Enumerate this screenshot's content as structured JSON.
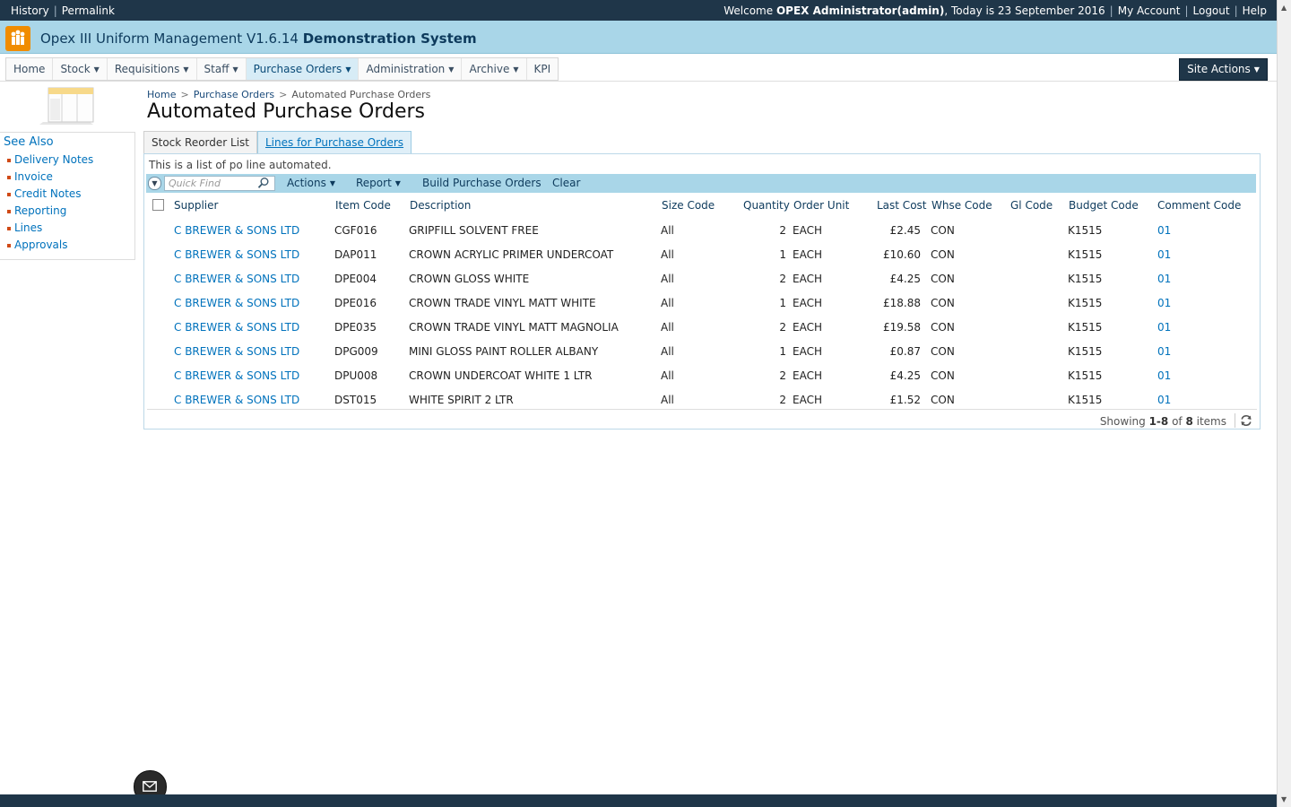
{
  "topbar": {
    "history": "History",
    "permalink": "Permalink",
    "welcome_prefix": "Welcome",
    "user": "OPEX Administrator(admin)",
    "today": ", Today is 23 September 2016",
    "my_account": "My Account",
    "logout": "Logout",
    "help": "Help"
  },
  "title": {
    "app": "Opex III Uniform Management V1.6.14",
    "system": "Demonstration System"
  },
  "nav": {
    "items": [
      {
        "label": "Home"
      },
      {
        "label": "Stock"
      },
      {
        "label": "Requisitions"
      },
      {
        "label": "Staff"
      },
      {
        "label": "Purchase Orders"
      },
      {
        "label": "Administration"
      },
      {
        "label": "Archive"
      },
      {
        "label": "KPI"
      }
    ],
    "site_actions": "Site Actions"
  },
  "see_also": {
    "title": "See Also",
    "items": [
      "Delivery Notes",
      "Invoice",
      "Credit Notes",
      "Reporting",
      "Lines",
      "Approvals"
    ]
  },
  "breadcrumb": {
    "home": "Home",
    "purchase_orders": "Purchase Orders",
    "current": "Automated Purchase Orders"
  },
  "page_title": "Automated Purchase Orders",
  "tabs": [
    "Stock Reorder List",
    "Lines for Purchase Orders"
  ],
  "panel_description": "This is a list of po line automated.",
  "toolbar": {
    "quick_find_placeholder": "Quick Find",
    "actions": "Actions",
    "report": "Report",
    "build": "Build Purchase Orders",
    "clear": "Clear"
  },
  "columns": [
    "Supplier",
    "Item Code",
    "Description",
    "Size Code",
    "Quantity",
    "Order Unit",
    "Last Cost",
    "Whse Code",
    "Gl Code",
    "Budget Code",
    "Comment Code"
  ],
  "rows": [
    {
      "supplier": "C BREWER & SONS LTD",
      "item": "CGF016",
      "desc": "GRIPFILL SOLVENT FREE",
      "size": "All",
      "qty": "2",
      "unit": "EACH",
      "cost": "£2.45",
      "whse": "CON",
      "gl": "",
      "budget": "K1515",
      "comment": "01"
    },
    {
      "supplier": "C BREWER & SONS LTD",
      "item": "DAP011",
      "desc": "CROWN ACRYLIC PRIMER UNDERCOAT",
      "size": "All",
      "qty": "1",
      "unit": "EACH",
      "cost": "£10.60",
      "whse": "CON",
      "gl": "",
      "budget": "K1515",
      "comment": "01"
    },
    {
      "supplier": "C BREWER & SONS LTD",
      "item": "DPE004",
      "desc": "CROWN GLOSS WHITE",
      "size": "All",
      "qty": "2",
      "unit": "EACH",
      "cost": "£4.25",
      "whse": "CON",
      "gl": "",
      "budget": "K1515",
      "comment": "01"
    },
    {
      "supplier": "C BREWER & SONS LTD",
      "item": "DPE016",
      "desc": "CROWN TRADE VINYL MATT WHITE",
      "size": "All",
      "qty": "1",
      "unit": "EACH",
      "cost": "£18.88",
      "whse": "CON",
      "gl": "",
      "budget": "K1515",
      "comment": "01"
    },
    {
      "supplier": "C BREWER & SONS LTD",
      "item": "DPE035",
      "desc": "CROWN TRADE VINYL MATT MAGNOLIA",
      "size": "All",
      "qty": "2",
      "unit": "EACH",
      "cost": "£19.58",
      "whse": "CON",
      "gl": "",
      "budget": "K1515",
      "comment": "01"
    },
    {
      "supplier": "C BREWER & SONS LTD",
      "item": "DPG009",
      "desc": "MINI GLOSS PAINT ROLLER ALBANY",
      "size": "All",
      "qty": "1",
      "unit": "EACH",
      "cost": "£0.87",
      "whse": "CON",
      "gl": "",
      "budget": "K1515",
      "comment": "01"
    },
    {
      "supplier": "C BREWER & SONS LTD",
      "item": "DPU008",
      "desc": "CROWN UNDERCOAT WHITE 1 LTR",
      "size": "All",
      "qty": "2",
      "unit": "EACH",
      "cost": "£4.25",
      "whse": "CON",
      "gl": "",
      "budget": "K1515",
      "comment": "01"
    },
    {
      "supplier": "C BREWER & SONS LTD",
      "item": "DST015",
      "desc": "WHITE SPIRIT 2 LTR",
      "size": "All",
      "qty": "2",
      "unit": "EACH",
      "cost": "£1.52",
      "whse": "CON",
      "gl": "",
      "budget": "K1515",
      "comment": "01"
    }
  ],
  "pager": {
    "prefix": "Showing ",
    "range": "1-8",
    "of": " of ",
    "total": "8",
    "suffix": " items"
  },
  "icons": {
    "logo": "people-logo-icon",
    "site": "site-table-icon",
    "search": "search-icon",
    "refresh": "refresh-icon",
    "mail": "mail-icon",
    "caret": "caret-down-icon"
  },
  "colors": {
    "topbar": "#1f3649",
    "titlebar": "#a9d6e8",
    "link": "#0072bc",
    "accent_orange": "#f08c00"
  }
}
